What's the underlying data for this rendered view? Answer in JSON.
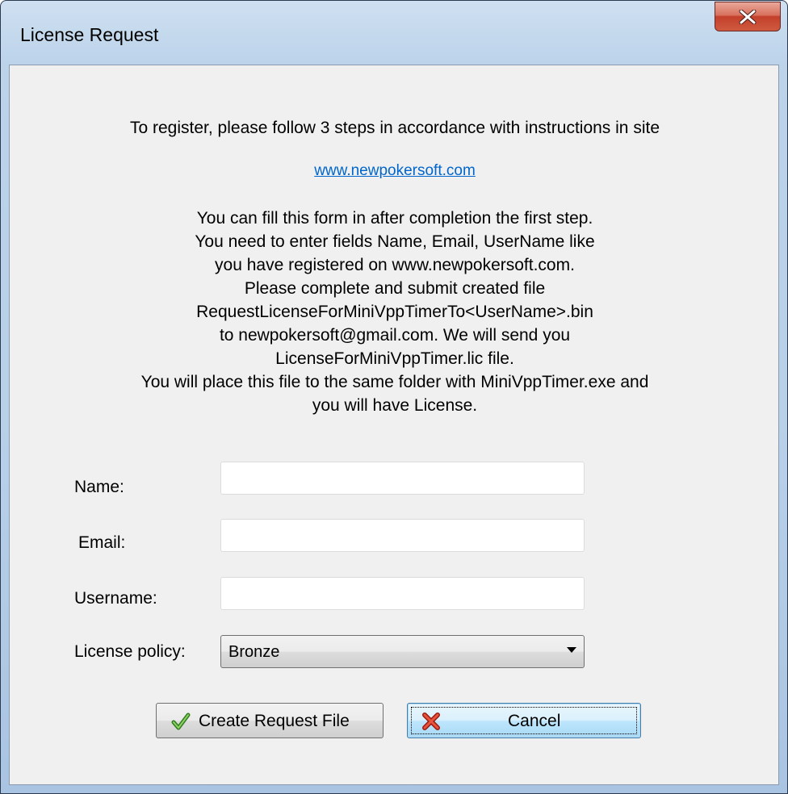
{
  "window": {
    "title": "License Request",
    "close_glyph": "x"
  },
  "intro": {
    "line1": "To register, please follow 3 steps in accordance with instructions in site",
    "link": "www.newpokersoft.com",
    "instructions": [
      "You can fill this form in after completion the first step.",
      "You need to enter fields Name, Email, UserName like",
      "you have registered on www.newpokersoft.com.",
      "Please complete and submit created file",
      "RequestLicenseForMiniVppTimerTo<UserName>.bin",
      "to newpokersoft@gmail.com. We will send you",
      "LicenseForMiniVppTimer.lic file.",
      "You will place this file to the same folder with MiniVppTimer.exe and",
      "you will have License."
    ]
  },
  "form": {
    "name_label": "Name:",
    "name_value": "",
    "email_label": "Email:",
    "email_value": "",
    "username_label": "Username:",
    "username_value": "",
    "policy_label": "License policy:",
    "policy_value": "Bronze"
  },
  "buttons": {
    "create_label": "Create Request File",
    "cancel_label": "Cancel"
  },
  "colors": {
    "link": "#0066cc",
    "client_bg": "#f0f0f0",
    "close_button": "#c3402b"
  },
  "icons": {
    "close": "close-icon",
    "create": "checkmark-icon",
    "cancel": "cross-icon",
    "dropdown": "chevron-down-icon"
  }
}
